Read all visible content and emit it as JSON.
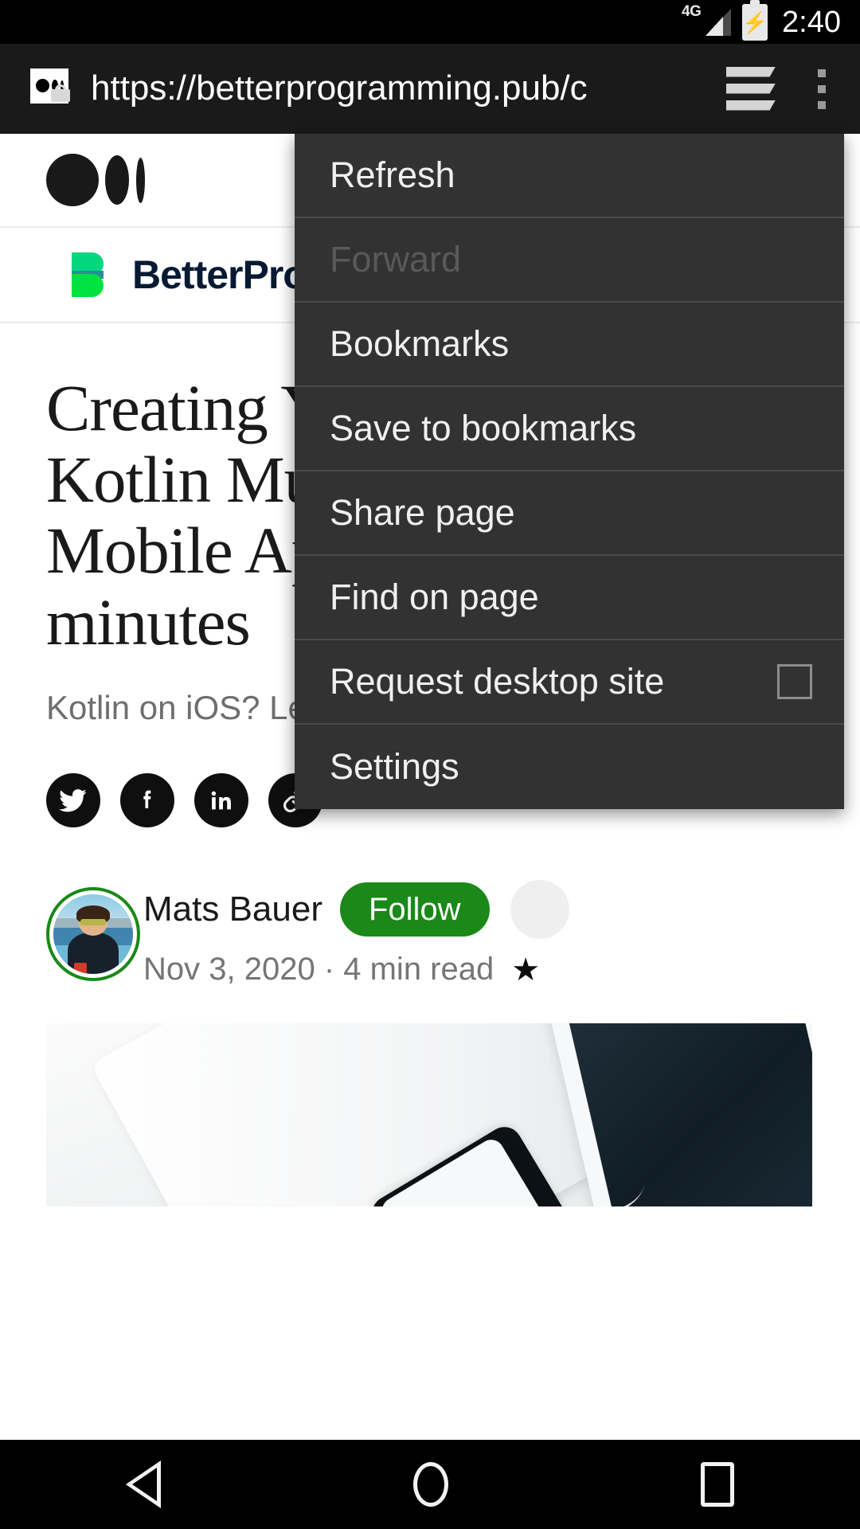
{
  "status_bar": {
    "network": "4G",
    "battery_icon": "battery-charging-icon",
    "time": "2:40"
  },
  "browser": {
    "site_icon": "medium-favicon-icon",
    "lock_icon": "lock-icon",
    "url": "https://betterprogramming.pub/c",
    "tabs_icon": "tabs-stack-icon",
    "overflow_icon": "overflow-menu-icon"
  },
  "overflow_menu": {
    "items": [
      {
        "label": "Refresh",
        "disabled": false,
        "checkbox": false
      },
      {
        "label": "Forward",
        "disabled": true,
        "checkbox": false
      },
      {
        "label": "Bookmarks",
        "disabled": false,
        "checkbox": false
      },
      {
        "label": "Save to bookmarks",
        "disabled": false,
        "checkbox": false
      },
      {
        "label": "Share page",
        "disabled": false,
        "checkbox": false
      },
      {
        "label": "Find on page",
        "disabled": false,
        "checkbox": false
      },
      {
        "label": "Request desktop site",
        "disabled": false,
        "checkbox": true,
        "checked": false
      },
      {
        "label": "Settings",
        "disabled": false,
        "checkbox": false
      }
    ]
  },
  "page": {
    "medium_logo": "medium-logo-icon",
    "publication": {
      "mark": "better-programming-mark-icon",
      "name_part1": "BetterPro",
      "name_part2": ""
    },
    "article": {
      "title": "Creating Your\nKotlin Multi\nMobile App\nminutes",
      "subtitle": "Kotlin on iOS? Let’s",
      "share": [
        {
          "name": "twitter-icon"
        },
        {
          "name": "facebook-icon"
        },
        {
          "name": "linkedin-icon"
        },
        {
          "name": "link-icon"
        }
      ],
      "author": "Mats Bauer",
      "follow_label": "Follow",
      "meta": "Nov 3, 2020 · 4 min read",
      "star_glyph": "★",
      "hero_image": "laptop-tablet-phone-photo"
    }
  },
  "nav_bar": {
    "back": "back-triangle-icon",
    "home": "home-circle-icon",
    "recents": "recents-square-icon"
  },
  "colors": {
    "status_bar_bg": "#000000",
    "toolbar_bg": "#1a1a1a",
    "menu_bg": "#323232",
    "accent_green": "#1a8917",
    "brand_green": "#00d66e"
  }
}
